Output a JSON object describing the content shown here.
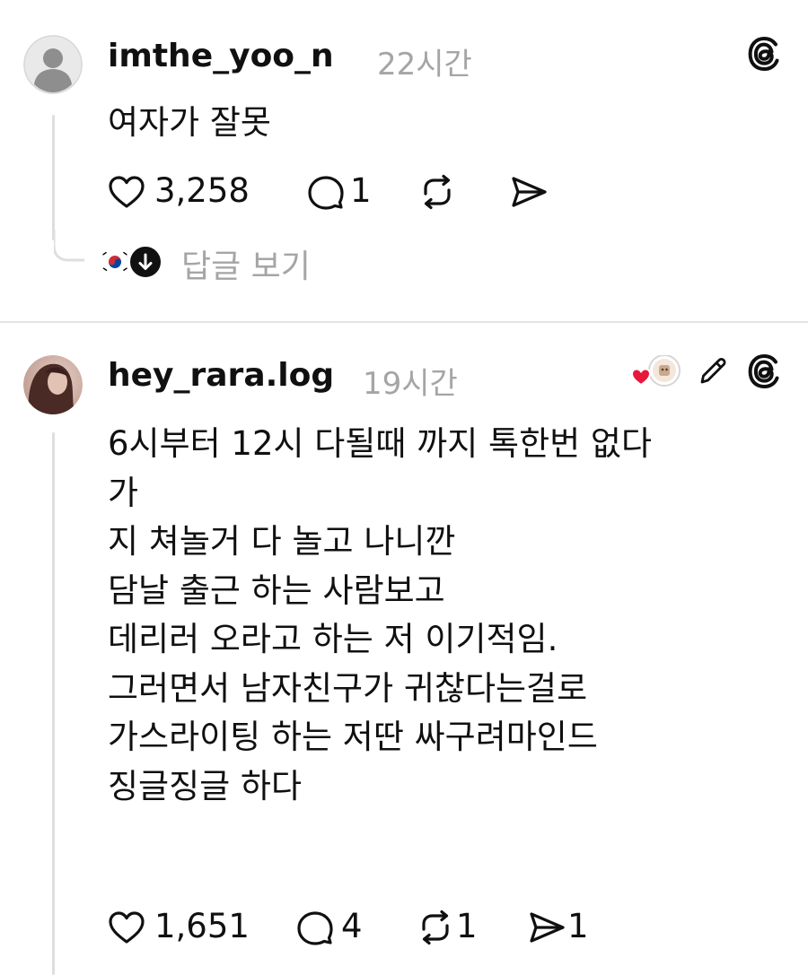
{
  "posts": [
    {
      "username": "imthe_yoo_n",
      "time": "22시간",
      "body": "여자가 잘못",
      "likes": "3,258",
      "comments": "1",
      "reposts": "",
      "shares": "",
      "view_replies_label": "답글 보기",
      "reply_avatar_icon": "korean-flag-avatar",
      "has_threads_logo": true
    },
    {
      "username": "hey_rara.log",
      "time": "19시간",
      "body": "6시부터 12시 다될때 까지 톡한번 없다\n가\n지 쳐놀거 다 놀고 나니깐\n담날 출근 하는 사람보고\n데리러 오라고 하는 저 이기적임.\n그러면서 남자친구가 귀찮다는걸로\n가스라이팅 하는 저딴 싸구려마인드\n징글징글 하다",
      "likes": "1,651",
      "comments": "4",
      "reposts": "1",
      "shares": "1",
      "has_threads_logo": true,
      "has_edit_icon": true,
      "reaction_icons": [
        "heart-icon",
        "author-liked-avatar"
      ]
    }
  ],
  "colors": {
    "text": "#101010",
    "secondary": "#a5a5a5",
    "divider": "#e4e4e4",
    "heart": "#e8173c"
  }
}
